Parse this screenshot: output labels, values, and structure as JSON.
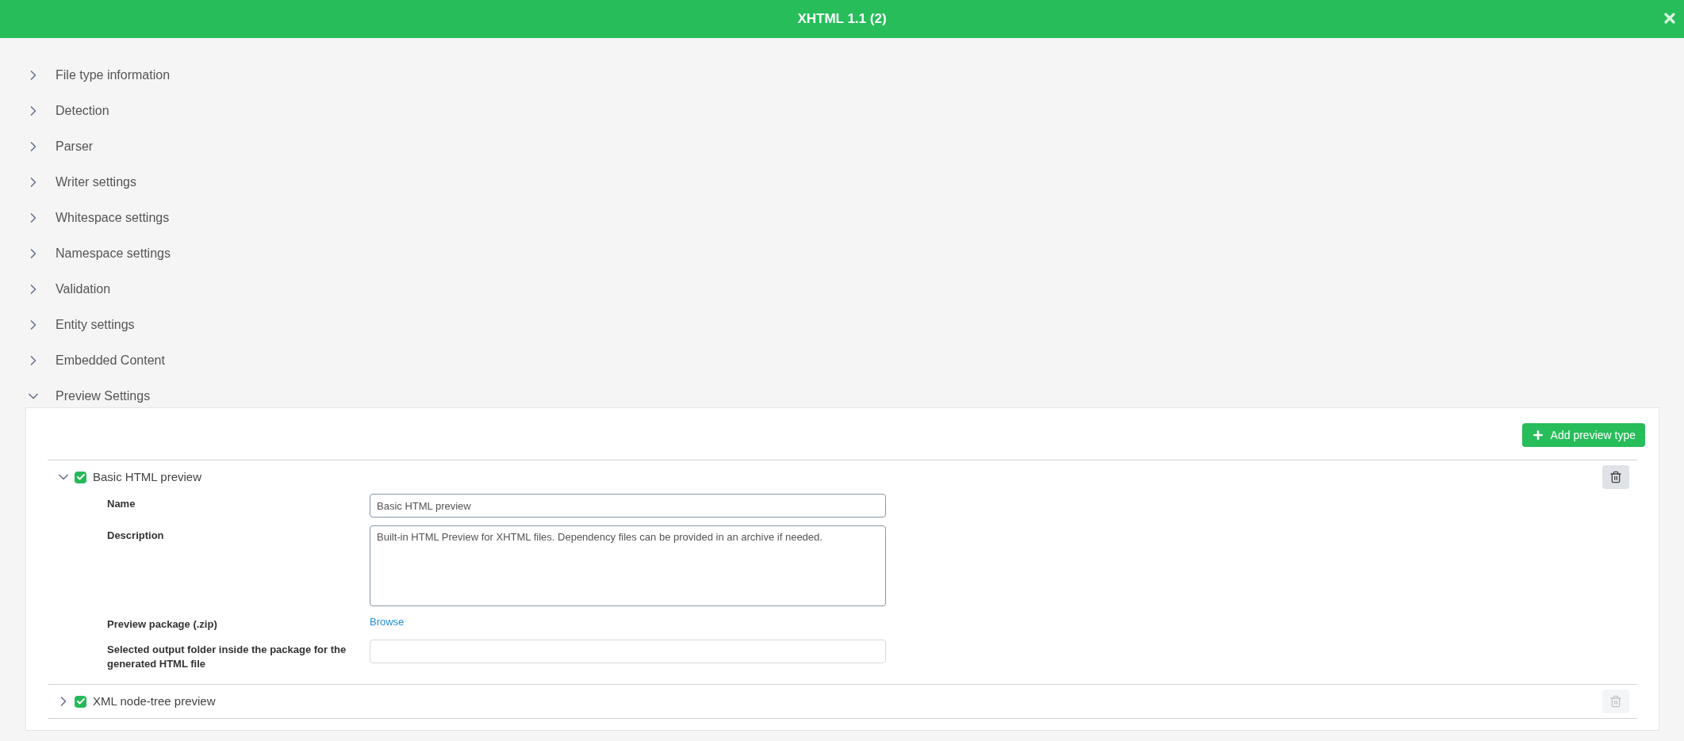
{
  "window": {
    "title": "XHTML 1.1 (2)"
  },
  "sections": [
    {
      "label": "File type information",
      "expanded": false
    },
    {
      "label": "Detection",
      "expanded": false
    },
    {
      "label": "Parser",
      "expanded": false
    },
    {
      "label": "Writer settings",
      "expanded": false
    },
    {
      "label": "Whitespace settings",
      "expanded": false
    },
    {
      "label": "Namespace settings",
      "expanded": false
    },
    {
      "label": "Validation",
      "expanded": false
    },
    {
      "label": "Entity settings",
      "expanded": false
    },
    {
      "label": "Embedded Content",
      "expanded": false
    },
    {
      "label": "Preview Settings",
      "expanded": true
    }
  ],
  "preview": {
    "add_button": "Add preview type",
    "types": [
      {
        "label": "Basic HTML preview",
        "expanded": true,
        "checked": true,
        "delete_disabled": false,
        "fields": [
          {
            "kind": "input",
            "label": "Name",
            "value": "Basic HTML preview"
          },
          {
            "kind": "textarea",
            "label": "Description",
            "value": "Built-in HTML Preview for XHTML files. Dependency files can be provided in an archive if needed."
          },
          {
            "kind": "link",
            "label": "Preview package (.zip)",
            "value": "Browse"
          },
          {
            "kind": "input",
            "label": "Selected output folder inside the package for the generated HTML file"
          }
        ]
      },
      {
        "label": "XML node-tree preview",
        "expanded": false,
        "checked": true,
        "delete_disabled": true
      }
    ]
  }
}
